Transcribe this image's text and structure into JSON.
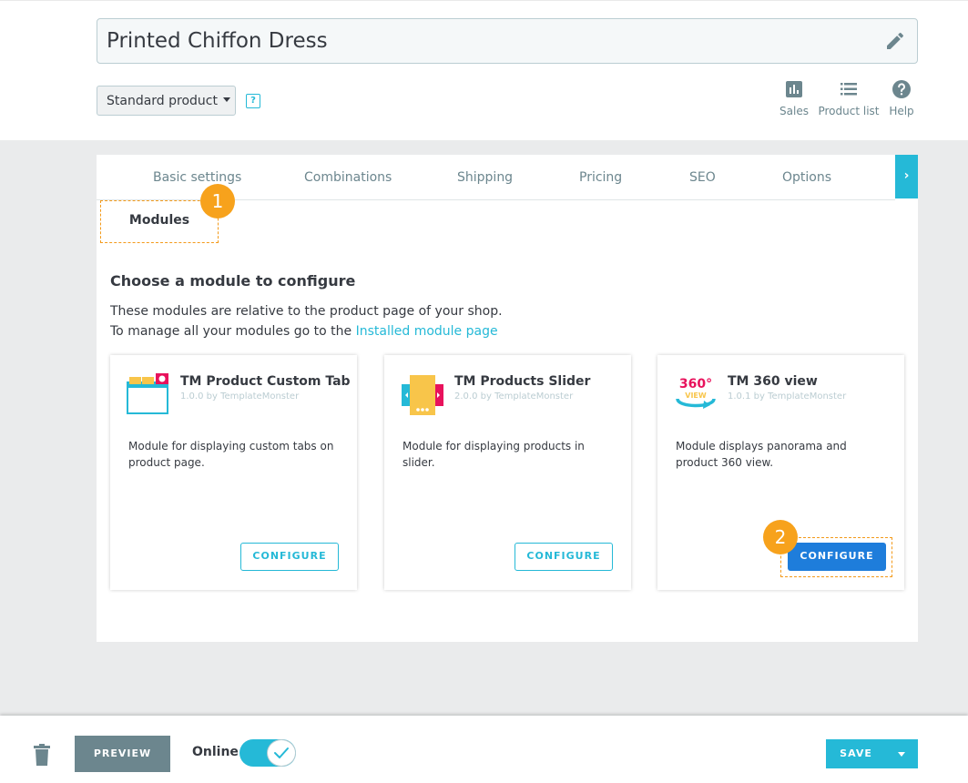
{
  "header": {
    "product_title": "Printed Chiffon Dress",
    "product_type": "Standard product",
    "help_symbol": "?",
    "quick_links": [
      {
        "label": "Sales",
        "icon": "bar-chart-icon"
      },
      {
        "label": "Product list",
        "icon": "list-icon"
      },
      {
        "label": "Help",
        "icon": "help-icon"
      }
    ]
  },
  "tabs": {
    "items": [
      "Basic settings",
      "Combinations",
      "Shipping",
      "Pricing",
      "SEO",
      "Options"
    ],
    "active": "Modules",
    "next_symbol": "›"
  },
  "annotations": {
    "badge_1": "1",
    "badge_2": "2"
  },
  "modules": {
    "title": "Choose a module to configure",
    "desc_line1": "These modules are relative to the product page of your shop.",
    "desc_line2_prefix": "To manage all your modules go to the ",
    "desc_line2_link": "Installed module page",
    "cards": [
      {
        "name": "TM Product Custom Tab",
        "version": "1.0.0 by TemplateMonster",
        "description": "Module for displaying custom tabs on product page.",
        "button": "CONFIGURE",
        "icon": "custom-tab-icon"
      },
      {
        "name": "TM Products Slider",
        "version": "2.0.0 by TemplateMonster",
        "description": "Module for displaying products in slider.",
        "button": "CONFIGURE",
        "icon": "slider-icon"
      },
      {
        "name": "TM 360 view",
        "version": "1.0.1 by TemplateMonster",
        "description": "Module displays panorama and product 360 view.",
        "button": "CONFIGURE",
        "icon": "360-view-icon"
      }
    ]
  },
  "footer": {
    "preview_label": "PREVIEW",
    "online_label": "Online",
    "online_enabled": true,
    "save_label": "SAVE"
  },
  "colors": {
    "accent": "#25b9d7",
    "primary_button": "#1e7ddb",
    "annotation": "#f7a21c",
    "preview_button": "#6c868e"
  }
}
